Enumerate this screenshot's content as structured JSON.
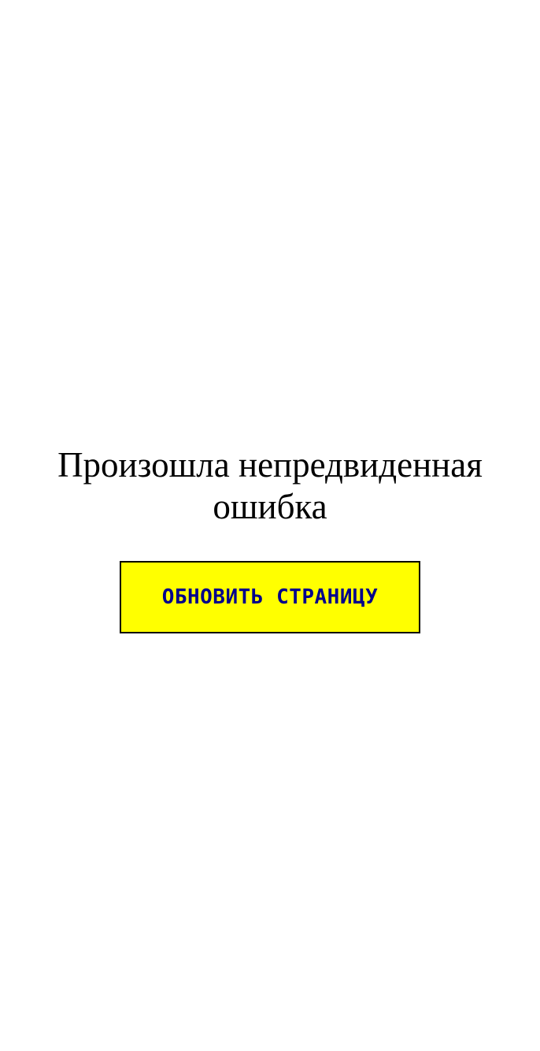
{
  "error": {
    "message": "Произошла непредвиденная ошибка",
    "reload_label": "ОБНОВИТЬ СТРАНИЦУ"
  },
  "colors": {
    "background": "#ffffff",
    "button_background": "#ffff00",
    "button_text": "#00008b",
    "button_border": "#000000"
  }
}
